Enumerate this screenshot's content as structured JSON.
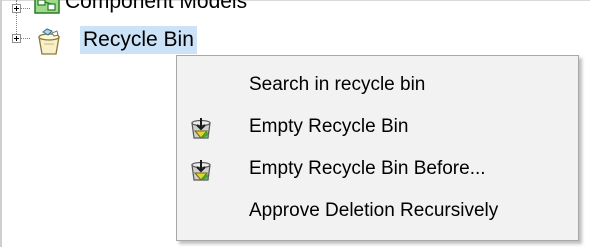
{
  "tree": {
    "nodes": [
      {
        "label": "Component Models",
        "icon": "component-models-icon"
      },
      {
        "label": "Recycle Bin",
        "icon": "recycle-bin-icon",
        "selected": true
      }
    ]
  },
  "context_menu": {
    "items": [
      {
        "label": "Search in recycle bin",
        "icon": null
      },
      {
        "label": "Empty Recycle Bin",
        "icon": "empty-recycle-bin-icon"
      },
      {
        "label": "Empty Recycle Bin Before...",
        "icon": "empty-recycle-bin-before-icon"
      },
      {
        "label": "Approve Deletion Recursively",
        "icon": null
      }
    ]
  },
  "colors": {
    "selection": "#cce3f7",
    "menu_background": "#f2f2f2",
    "menu_border": "#a8a8a8"
  }
}
